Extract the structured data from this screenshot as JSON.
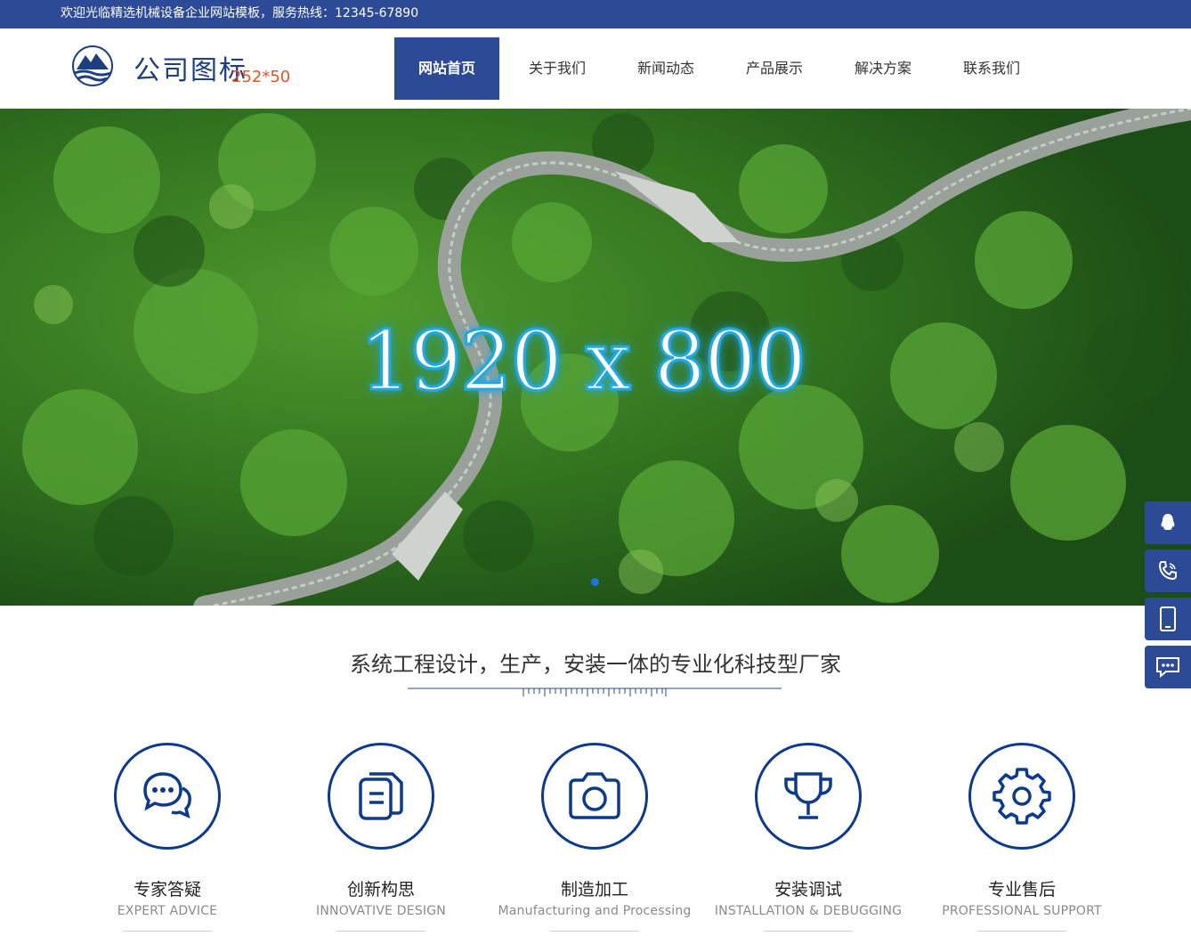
{
  "topbar": {
    "text": "欢迎光临精选机械设备企业网站模板，服务热线：12345-67890"
  },
  "logo": {
    "name": "公司图标",
    "size_label": "252*50"
  },
  "nav": {
    "items": [
      {
        "label": "网站首页",
        "active": true
      },
      {
        "label": "关于我们"
      },
      {
        "label": "新闻动态"
      },
      {
        "label": "产品展示"
      },
      {
        "label": "解决方案"
      },
      {
        "label": "联系我们"
      }
    ]
  },
  "banner": {
    "caption": "1920 x 800"
  },
  "side_buttons": [
    "qq-icon",
    "phone-icon",
    "mobile-icon",
    "message-icon"
  ],
  "slogan": "系统工程设计，生产，安装一体的专业化科技型厂家",
  "features": [
    {
      "cn": "专家答疑",
      "en": "EXPERT ADVICE",
      "icon": "chat-icon"
    },
    {
      "cn": "创新构思",
      "en": "INNOVATIVE DESIGN",
      "icon": "document-icon"
    },
    {
      "cn": "制造加工",
      "en": "Manufacturing and Processing",
      "icon": "camera-icon"
    },
    {
      "cn": "安装调试",
      "en": "INSTALLATION & DEBUGGING",
      "icon": "trophy-icon"
    },
    {
      "cn": "专业售后",
      "en": "PROFESSIONAL SUPPORT",
      "icon": "gear-icon"
    }
  ],
  "colors": {
    "primary": "#2c4a96",
    "icon_blue": "#0d3a8c",
    "accent_orange": "#e2552a"
  }
}
